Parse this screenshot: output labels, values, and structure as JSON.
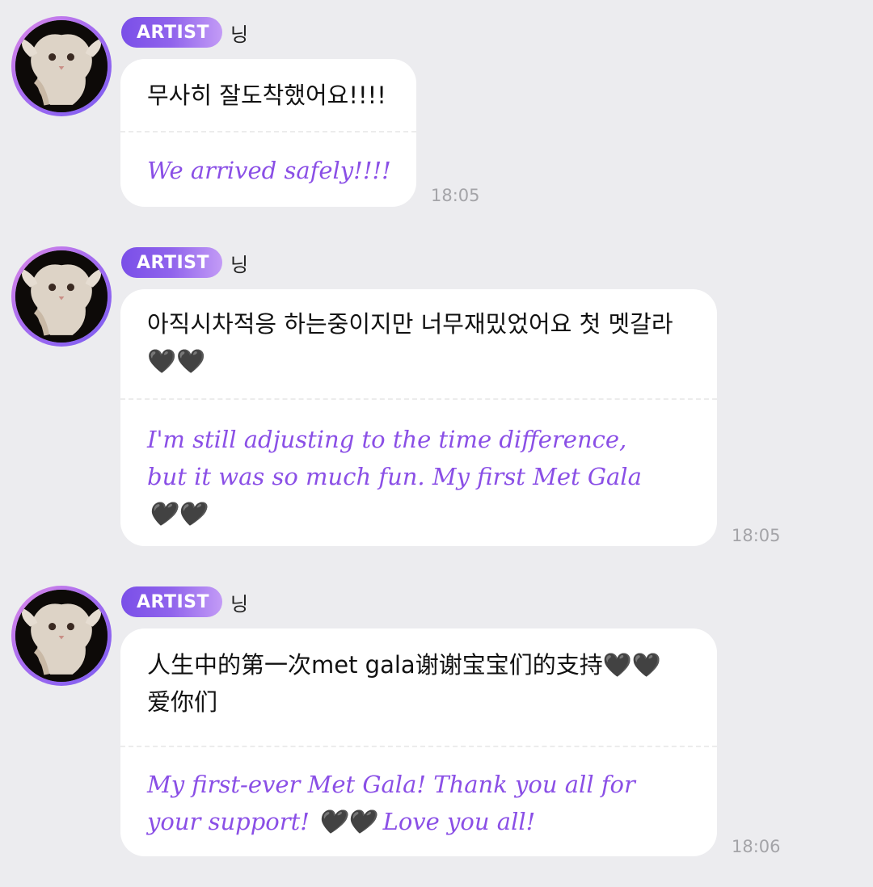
{
  "messages": [
    {
      "badge": "ARTIST",
      "name": "닝",
      "original": "무사히 잘도착했어요!!!!",
      "translation": "We arrived safely!!!!",
      "time": "18:05"
    },
    {
      "badge": "ARTIST",
      "name": "닝",
      "original": "아직시차적응 하는중이지만 너무재밌었어요 첫 멧갈라 🖤🖤",
      "translation": "I'm still adjusting to the time difference, but it was so much fun. My first Met Gala 🖤🖤",
      "time": "18:05"
    },
    {
      "badge": "ARTIST",
      "name": "닝",
      "original": "人生中的第一次met gala谢谢宝宝们的支持🖤🖤爱你们",
      "translation": "My first-ever Met Gala! Thank you all for your support! 🖤🖤 Love you all!",
      "time": "18:06"
    }
  ]
}
